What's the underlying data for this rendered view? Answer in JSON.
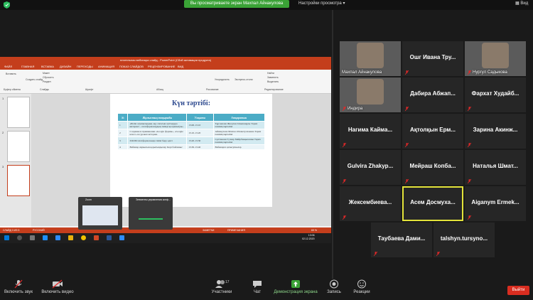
{
  "topbar": {
    "share_banner": "Вы просматриваете экран Махпал Айнакулова",
    "view_settings": "Настройки просмотра",
    "view_label": "Вид"
  },
  "shared_screen": {
    "ppt_title": "нлятельная вебинара слайд - PowerPoint (Сбой активации продукта)",
    "ppt_tabs": [
      "ФАЙЛ",
      "ГЛАВНАЯ",
      "ВСТАВКА",
      "ДИЗАЙН",
      "ПЕРЕХОДЫ",
      "АНИМАЦИЯ",
      "ПОКАЗ СЛАЙДОВ",
      "РЕЦЕНЗИРОВАНИЕ",
      "ВИД"
    ],
    "ribbon_groups": [
      "Буфер обмена",
      "Слайды",
      "Шрифт",
      "Абзац",
      "Рисование",
      "Редактирование"
    ],
    "ribbon_items": [
      "Вставить",
      "Создать слайд",
      "Макет",
      "Сбросить",
      "Раздел",
      "Упорядочить",
      "Экспресс-стили",
      "Найти",
      "Заменить",
      "Выделить"
    ],
    "slide_numbers": [
      "1",
      "2",
      "3"
    ],
    "slide": {
      "title": "Күн тәртібі:",
      "headers": [
        "№",
        "Жұмыстың тақырыбы",
        "Уақыты",
        "Атқаратын"
      ],
      "rows": [
        [
          "1",
          "«Білім алушылардың оқу сапасын арттыруда интернет – платформалардың тиімді қолданылуы»",
          "13.00-13.10",
          "Тұрсынова Жасұлан Ілғышаңұлы Тарих пәнінің мұғалімі"
        ],
        [
          "2",
          "Создание и применение «Google формы», «Google класс» на уроках истории.",
          "13.10-13.20",
          "Айнакулова Махпал Рахметуллаевна Тарих пәнінің мұғалімі"
        ],
        [
          "3",
          "ZOOM платформасында тиімі беру әдісі",
          "13.20-13.30",
          "Сұлтанова Гүлнар Мейрбекқызовны Тарих пәнінің мұғалімі"
        ],
        [
          "4",
          "Вебинар жұмысын қорытындылау. Кері байланыс",
          "13.30-13.40",
          "Вебинарға қатысушылар"
        ]
      ]
    },
    "notes": "Заметки к слайду",
    "status": "СЛАЙД 3 ИЗ 3",
    "status_lang": "РУССКИЙ",
    "status_notes": "ЗАМЕТКИ",
    "status_comments": "ПРИМЕЧАНИЯ",
    "zoom_level": "69 %",
    "clock_time": "13:06",
    "clock_date": "02.12.2020",
    "popups": [
      "Zoom",
      "Элементы управления конф..."
    ]
  },
  "gallery": [
    {
      "kind": "video",
      "label": "Махпал Айнакулова",
      "muted": false
    },
    {
      "kind": "name",
      "name": "Ошг Ивана Тру...",
      "muted": true
    },
    {
      "kind": "video",
      "label": "Нургул Садыкова",
      "muted": true
    },
    {
      "kind": "video",
      "label": "Индира",
      "muted": true
    },
    {
      "kind": "name",
      "name": "Дабира Абжап...",
      "muted": true
    },
    {
      "kind": "name",
      "name": "Фархат Худайб...",
      "muted": true
    },
    {
      "kind": "name",
      "name": "Нагима Кайма...",
      "muted": true
    },
    {
      "kind": "name",
      "name": "Ақтолқын Ерм...",
      "muted": true
    },
    {
      "kind": "name",
      "name": "Зарина Акинж...",
      "muted": true
    },
    {
      "kind": "name",
      "name": "Gulvira Zhakyp...",
      "muted": true
    },
    {
      "kind": "name",
      "name": "Мейраш Копба...",
      "muted": true
    },
    {
      "kind": "name",
      "name": "Наталья Шмат...",
      "muted": true
    },
    {
      "kind": "name",
      "name": "Жексембиева...",
      "muted": true
    },
    {
      "kind": "name",
      "name": "Асем Досмуха...",
      "muted": false,
      "active": true
    },
    {
      "kind": "name",
      "name": "Aiganym Ermek...",
      "muted": true
    },
    {
      "kind": "name",
      "name": "Таубаева Дами...",
      "muted": true
    },
    {
      "kind": "name",
      "name": "talshyn.tursyno...",
      "muted": true
    }
  ],
  "toolbar": {
    "unmute": "Включить звук",
    "start_video": "Включить видео",
    "participants": "Участники",
    "participants_count": "17",
    "chat": "Чат",
    "share_screen": "Демонстрация экрана",
    "record": "Запись",
    "reactions": "Реакции",
    "end": "Выйти"
  },
  "colors": {
    "share_green": "#3aa236",
    "ppt_red": "#c43e1c",
    "end_red": "#d92d20",
    "active_speaker": "#e3e33a",
    "table_header": "#4bacc6"
  }
}
